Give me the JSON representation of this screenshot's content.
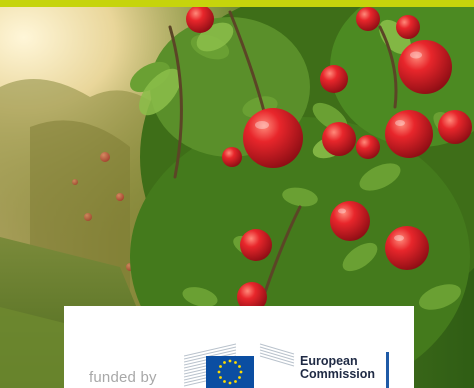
{
  "photo": {
    "subject": "apple-tree-branches-with-red-apples"
  },
  "funding": {
    "funded_by": "funded by",
    "ec_name_line1": "European",
    "ec_name_line2": "Commission"
  },
  "colors": {
    "top_bar": "#c6d40c",
    "eu_blue": "#0b4ea2",
    "eu_stars": "#ffdd00",
    "ec_text": "#1f2a44",
    "ec_rule": "#1f5aa6"
  }
}
